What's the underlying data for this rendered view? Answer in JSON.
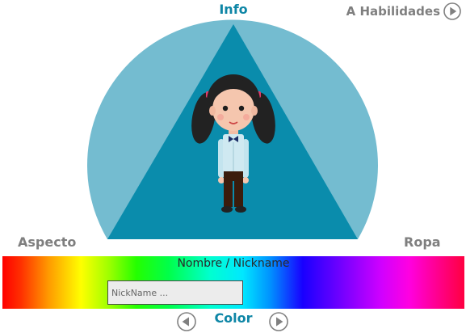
{
  "header": {
    "info_title": "Info",
    "next_section_label": "A Habilidades",
    "next_icon": "play-circle-icon"
  },
  "stage": {
    "left_tab": "Aspecto",
    "right_tab": "Ropa",
    "colors": {
      "dome": "#74bcd0",
      "triangle": "#0a8cac",
      "accent_text": "#0e86a6",
      "muted_text": "#7f7f7f"
    },
    "avatar": "girl-avatar"
  },
  "nickname": {
    "label": "Nombre / Nickname",
    "value": "",
    "placeholder": "NickName ..."
  },
  "color_picker": {
    "title": "Color",
    "prev_icon": "play-circle-left-icon",
    "next_icon": "play-circle-icon"
  }
}
